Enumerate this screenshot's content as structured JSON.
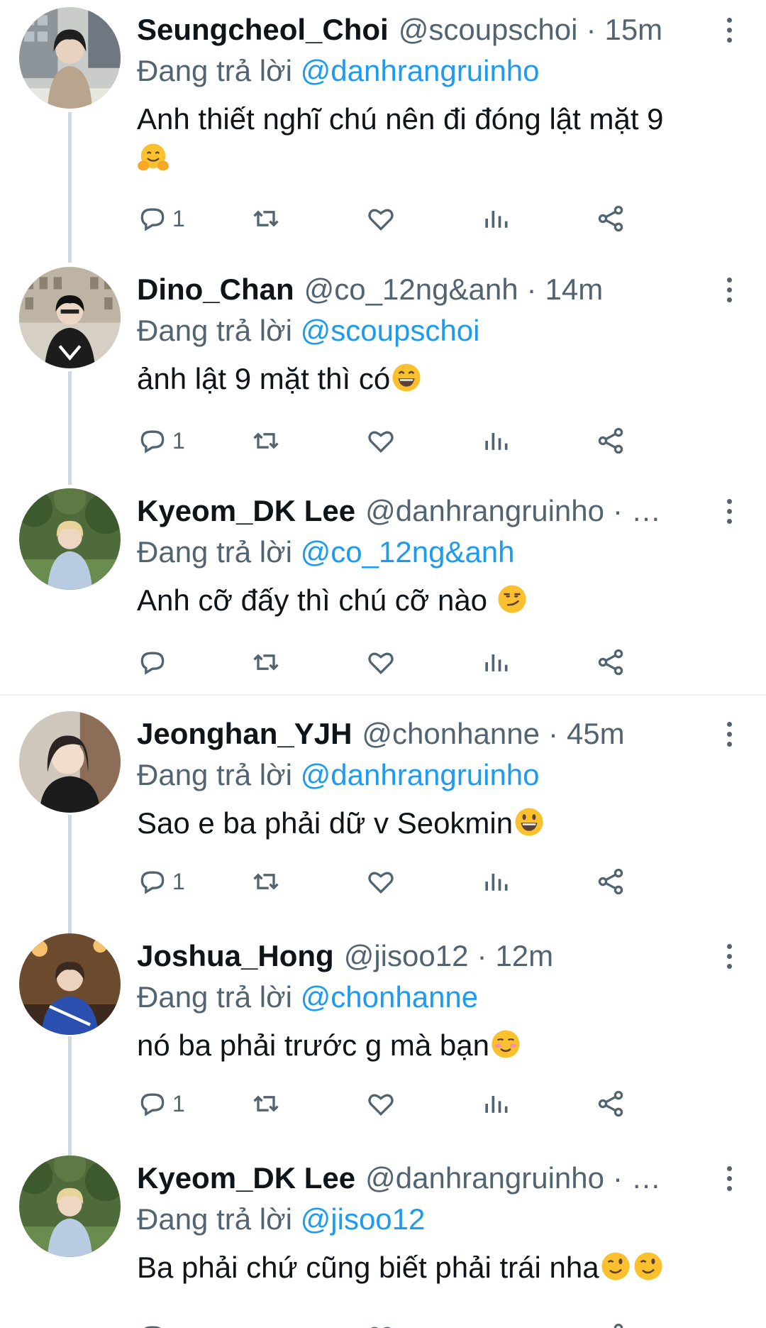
{
  "reply_prefix": "Đang trả lời",
  "tweets": [
    {
      "name": "Seungcheol_Choi",
      "handle": "@scoupschoi",
      "time": "15m",
      "reply_to": "@danhrangruinho",
      "text_line1": "Anh thiết nghĩ chú nên đi đóng lật mặt 9",
      "text_line2": "",
      "emoji": "hugging-face",
      "reply_count": "1"
    },
    {
      "name": "Dino_Chan",
      "handle": "@co_12ng&anh",
      "time": "14m",
      "reply_to": "@scoupschoi",
      "text": "ảnh lật 9 mặt thì có",
      "emoji": "grinning-face-smiling-eyes",
      "reply_count": "1"
    },
    {
      "name": "Kyeom_DK Lee",
      "handle": "@danhrangruinho",
      "time": "…",
      "reply_to": "@co_12ng&anh",
      "text": "Anh cỡ đấy thì chú cỡ nào ",
      "emoji": "smirking-face",
      "reply_count": ""
    },
    {
      "name": "Jeonghan_YJH",
      "handle": "@chonhanne",
      "time": "45m",
      "reply_to": "@danhrangruinho",
      "text": "Sao e ba phải dữ v Seokmin",
      "emoji": "grinning-face",
      "reply_count": "1"
    },
    {
      "name": "Joshua_Hong",
      "handle": "@jisoo12",
      "time": "12m",
      "reply_to": "@chonhanne",
      "text": "nó ba phải trước g mà bạn",
      "emoji": "smiling-face",
      "reply_count": "1"
    },
    {
      "name": "Kyeom_DK Lee",
      "handle": "@danhrangruinho",
      "time": "…",
      "reply_to": "@jisoo12",
      "text": "Ba phải chứ cũng biết phải trái nha",
      "emoji": "winking-face",
      "reply_count": ""
    }
  ],
  "colors": {
    "text": "#0f1419",
    "secondary": "#536471",
    "link": "#1d9bf0",
    "thread_line": "#cfd9de",
    "divider": "#eff3f4"
  },
  "icons": [
    "reply-icon",
    "retweet-icon",
    "like-icon",
    "views-icon",
    "share-icon",
    "more-options-icon"
  ]
}
